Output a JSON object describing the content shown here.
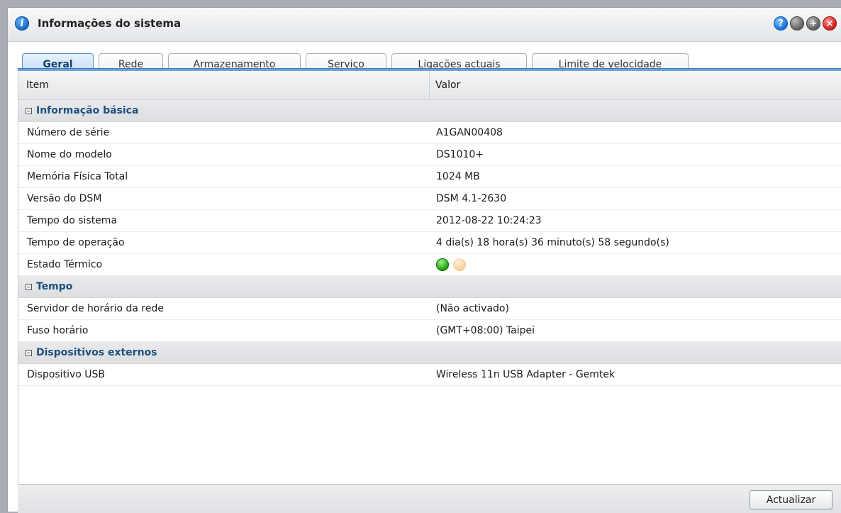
{
  "window": {
    "title": "Informações do sistema",
    "info_icon_glyph": "i"
  },
  "window_buttons": {
    "help_glyph": "?",
    "max_glyph": "+",
    "close_glyph": "×"
  },
  "tabs": [
    {
      "label": "Geral",
      "active": true
    },
    {
      "label": "Rede",
      "active": false
    },
    {
      "label": "Armazenamento",
      "active": false
    },
    {
      "label": "Serviço",
      "active": false
    },
    {
      "label": "Ligações actuais",
      "active": false
    },
    {
      "label": "Limite de velocidade",
      "active": false
    }
  ],
  "table": {
    "headers": {
      "item": "Item",
      "value": "Valor"
    },
    "groups": [
      {
        "title": "Informação básica",
        "rows": [
          {
            "item": "Número de série",
            "value": "A1GAN00408"
          },
          {
            "item": "Nome do modelo",
            "value": "DS1010+"
          },
          {
            "item": "Memória Física Total",
            "value": "1024 MB"
          },
          {
            "item": "Versão do DSM",
            "value": "DSM 4.1-2630"
          },
          {
            "item": "Tempo do sistema",
            "value": "2012-08-22 10:24:23"
          },
          {
            "item": "Tempo de operação",
            "value": "4 dia(s) 18 hora(s) 36 minuto(s) 58 segundo(s)"
          },
          {
            "item": "Estado Térmico",
            "value": ""
          }
        ]
      },
      {
        "title": "Tempo",
        "rows": [
          {
            "item": "Servidor de horário da rede",
            "value": "(Não activado)"
          },
          {
            "item": "Fuso horário",
            "value": "(GMT+08:00) Taipei"
          }
        ]
      },
      {
        "title": "Dispositivos externos",
        "rows": [
          {
            "item": "Dispositivo USB",
            "value": "Wireless 11n USB Adapter - Gemtek"
          }
        ]
      }
    ]
  },
  "thermal_status": {
    "indicators": [
      "green-status-dot",
      "orange-status-dot"
    ],
    "colors": {
      "green": "#1f9b12",
      "orange": "#f8cf97"
    }
  },
  "footer": {
    "refresh_label": "Actualizar"
  },
  "colors": {
    "active_tab": "#bcd9f3",
    "tab_underline": "#6da3d8",
    "group_title": "#1f4f7e"
  }
}
